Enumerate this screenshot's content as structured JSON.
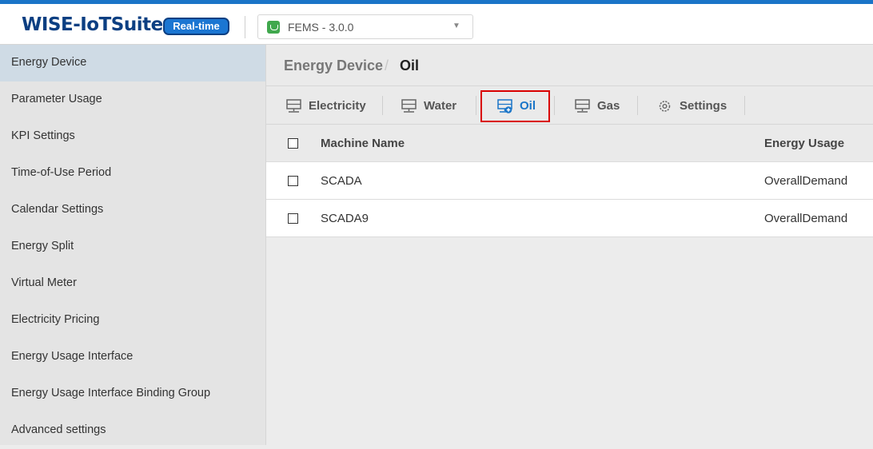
{
  "header": {
    "logo": "WISE-IoTSuite",
    "badge": "Real-time",
    "app_selector": {
      "value": "FEMS - 3.0.0",
      "icon": "energy-app-icon"
    }
  },
  "sidebar": {
    "items": [
      {
        "label": "Energy Device",
        "active": true
      },
      {
        "label": "Parameter Usage"
      },
      {
        "label": "KPI Settings"
      },
      {
        "label": "Time-of-Use Period"
      },
      {
        "label": "Calendar Settings"
      },
      {
        "label": "Energy Split"
      },
      {
        "label": "Virtual Meter"
      },
      {
        "label": "Electricity Pricing"
      },
      {
        "label": "Energy Usage Interface"
      },
      {
        "label": "Energy Usage Interface Binding Group"
      },
      {
        "label": "Advanced settings"
      }
    ]
  },
  "breadcrumb": {
    "root": "Energy Device",
    "separator": "/",
    "current": "Oil"
  },
  "tabs": [
    {
      "label": "Electricity",
      "icon": "device-icon"
    },
    {
      "label": "Water",
      "icon": "device-icon"
    },
    {
      "label": "Oil",
      "icon": "device-add-icon",
      "active": true
    },
    {
      "label": "Gas",
      "icon": "device-icon"
    },
    {
      "label": "Settings",
      "icon": "gear-icon"
    }
  ],
  "table": {
    "columns": [
      "Machine Name",
      "Energy Usage"
    ],
    "rows": [
      {
        "name": "SCADA",
        "usage": "OverallDemand"
      },
      {
        "name": "SCADA9",
        "usage": "OverallDemand"
      }
    ]
  },
  "colors": {
    "accent": "#1a75c8",
    "brand": "#0c3f82",
    "highlight_box": "#d90000"
  }
}
